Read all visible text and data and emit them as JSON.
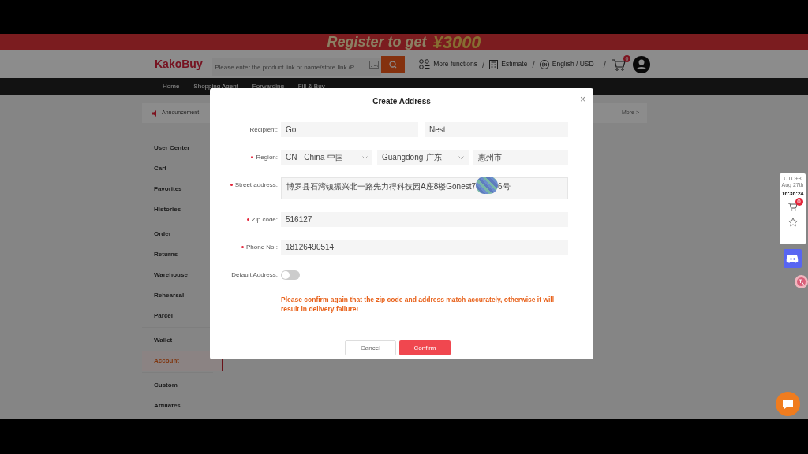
{
  "banner": {
    "text": "Register to get",
    "amount": "¥3000"
  },
  "header": {
    "logo": "KakoBuy",
    "search": {
      "placeholder": "Please enter the product link or name/store link /P"
    },
    "links": [
      {
        "label": "More functions",
        "kind": "grid"
      },
      {
        "label": "Estimate",
        "kind": "calc"
      },
      {
        "label": "English / USD",
        "kind": "lang"
      }
    ],
    "separator": "/",
    "cart_badge": "0"
  },
  "nav": [
    "Home",
    "Shopping Agent",
    "Forwarding",
    "Fill & Buy"
  ],
  "announcement": {
    "label": "Announcement",
    "more": "More >"
  },
  "sidebar": [
    [
      {
        "label": "User Center",
        "selected": false
      },
      {
        "label": "Cart",
        "selected": false
      },
      {
        "label": "Favorites",
        "selected": false
      },
      {
        "label": "Histories",
        "selected": false
      }
    ],
    [
      {
        "label": "Order",
        "selected": false
      },
      {
        "label": "Returns",
        "selected": false
      },
      {
        "label": "Warehouse",
        "selected": false
      },
      {
        "label": "Rehearsal",
        "selected": false
      },
      {
        "label": "Parcel",
        "selected": false
      }
    ],
    [
      {
        "label": "Wallet",
        "selected": false
      },
      {
        "label": "Account",
        "selected": true
      }
    ],
    [
      {
        "label": "Custom",
        "selected": false
      },
      {
        "label": "Affiliates",
        "selected": false
      }
    ]
  ],
  "dialog": {
    "title": "Create Address",
    "close": "×",
    "fields": [
      {
        "kind": "pair",
        "label": "Recipient:",
        "required": false,
        "values": [
          "Go",
          "Nest"
        ]
      },
      {
        "kind": "region",
        "label": "Region:",
        "required": true,
        "values": [
          "CN - China-中国",
          "Guangdong-广东",
          "惠州市"
        ]
      },
      {
        "kind": "textarea",
        "label": "Street address:",
        "required": true,
        "value_start": "博罗县石湾镇振兴北一路先力得科技园A座8楼Gonest7",
        "value_end": "6号"
      },
      {
        "kind": "input",
        "label": "Zip code:",
        "required": true,
        "value": "516127"
      },
      {
        "kind": "input",
        "label": "Phone No.:",
        "required": true,
        "value": "18126490514"
      },
      {
        "kind": "toggle",
        "label": "Default Address:",
        "required": false,
        "on": false
      }
    ],
    "warning": "Please confirm again that the zip code and address match accurately, otherwise it will result in delivery failure!",
    "buttons": [
      {
        "label": "Cancel",
        "kind": "secondary"
      },
      {
        "label": "Confirm",
        "kind": "primary"
      }
    ]
  },
  "side_widget": {
    "timezone": "UTC+8",
    "date": "Aug 27th",
    "time": "16:36:24",
    "cart_badge": "0"
  }
}
